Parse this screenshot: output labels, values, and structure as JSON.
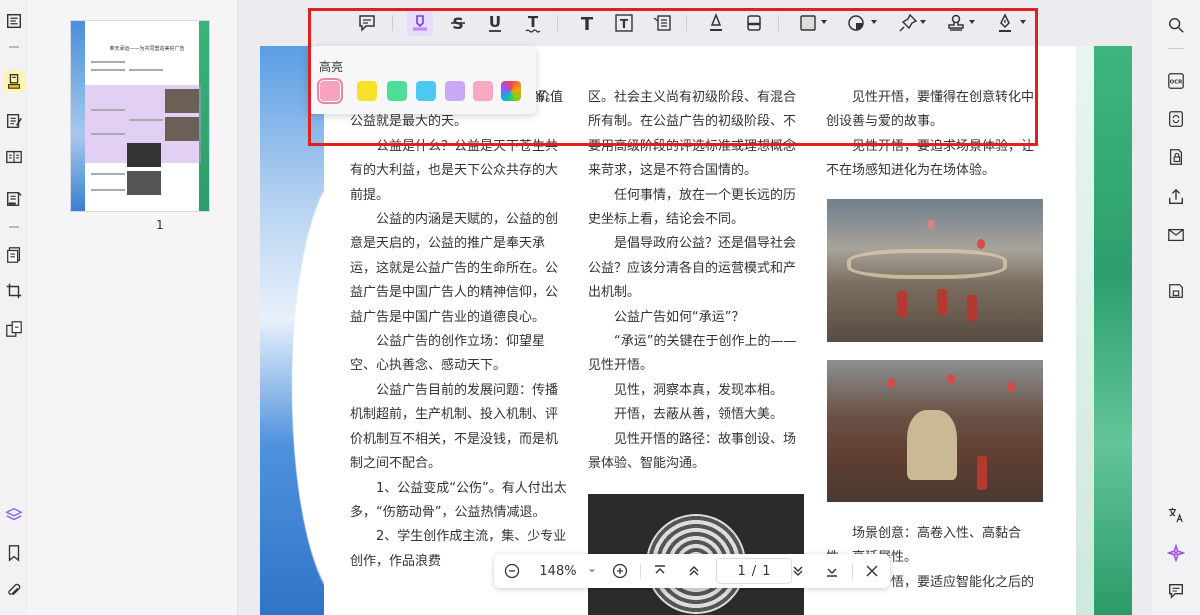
{
  "thumbnail": {
    "page_number": "1",
    "title": "奉天承运——为共同塑造美好广告"
  },
  "highlight_popup": {
    "title": "高亮",
    "colors": [
      "#f7a3bd",
      "#f7e02a",
      "#4ddf96",
      "#4cc9f0",
      "#c9a9f5",
      "#f9a8c2",
      "gradient"
    ],
    "selected_color": "#f7a3bd"
  },
  "toolbar": {
    "tools": [
      "comment-icon",
      "highlight-icon",
      "strikethrough-icon",
      "underline-icon",
      "squiggly-icon",
      "text-icon",
      "textbox-icon",
      "text-callout-icon",
      "pencil-icon",
      "eraser-icon",
      "shape-icon",
      "sticker-icon",
      "pin-icon",
      "stamp-icon",
      "signature-icon"
    ]
  },
  "document": {
    "col1": [
      {
        "indent": false,
        "text": "最大的理解，也是最有担当的理解。公益就是最大的天。"
      },
      {
        "indent": true,
        "text": "公益是什么？公益是天下苍生共有的大利益，也是天下公众共存的大前提。"
      },
      {
        "indent": true,
        "text": "公益的内涵是天赋的，公益的创意是天启的，公益的推广是奉天承运，这就是公益广告的生命所在。公益广告是中国广告人的精神信仰，公益广告是中国广告业的道德良心。"
      },
      {
        "indent": true,
        "text": "公益广告的创作立场：仰望星空、心执善念、感动天下。"
      },
      {
        "indent": true,
        "text": "公益广告目前的发展问题：传播机制超前，生产机制、投入机制、评价机制互不相关，不是没钱，而是机制之间不配合。"
      },
      {
        "indent": true,
        "text": "1、公益变成“公伤”。有人付出太多，“伤筋动骨”，公益热情减退。"
      },
      {
        "indent": true,
        "text": "2、学生创作成主流，集、少专业创作，作品浪费"
      }
    ],
    "col1_partial": "价值",
    "col2": [
      {
        "indent": false,
        "text": "区。社会主义尚有初级阶段、有混合所有制。在公益广告的初级阶段、不要用高级阶段的评选标准或理想概念来苛求，这是不符合国情的。"
      },
      {
        "indent": true,
        "text": "任何事情，放在一个更长远的历史坐标上看，结论会不同。"
      },
      {
        "indent": true,
        "text": "是倡导政府公益？还是倡导社会公益？应该分清各自的运营模式和产出机制。"
      },
      {
        "indent": true,
        "text": "公益广告如何“承运”？"
      },
      {
        "indent": true,
        "text": "“承运”的关键在于创作上的——见性开悟。"
      },
      {
        "indent": true,
        "text": "见性，洞察本真，发现本相。"
      },
      {
        "indent": true,
        "text": "开悟，去蔽从善，领悟大美。"
      },
      {
        "indent": true,
        "text": "见性开悟的路径：故事创设、场景体验、智能沟通。"
      }
    ],
    "col3_top": [
      {
        "indent": true,
        "text": "见性开悟，要懂得在创意转化中创设善与爱的故事。"
      },
      {
        "indent": true,
        "text": "见性开悟，要追求场景体验，让不在场感知进化为在场体验。"
      }
    ],
    "col3_bottom": [
      {
        "indent": true,
        "text": "场景创意：高卷入性、高黏合性、高延展性。"
      },
      {
        "indent": true,
        "text": "见性开悟，要适应智能化之后的"
      }
    ]
  },
  "zoom_bar": {
    "zoom": "148%",
    "page_current": "1",
    "page_separator": "/",
    "page_total": "1"
  }
}
